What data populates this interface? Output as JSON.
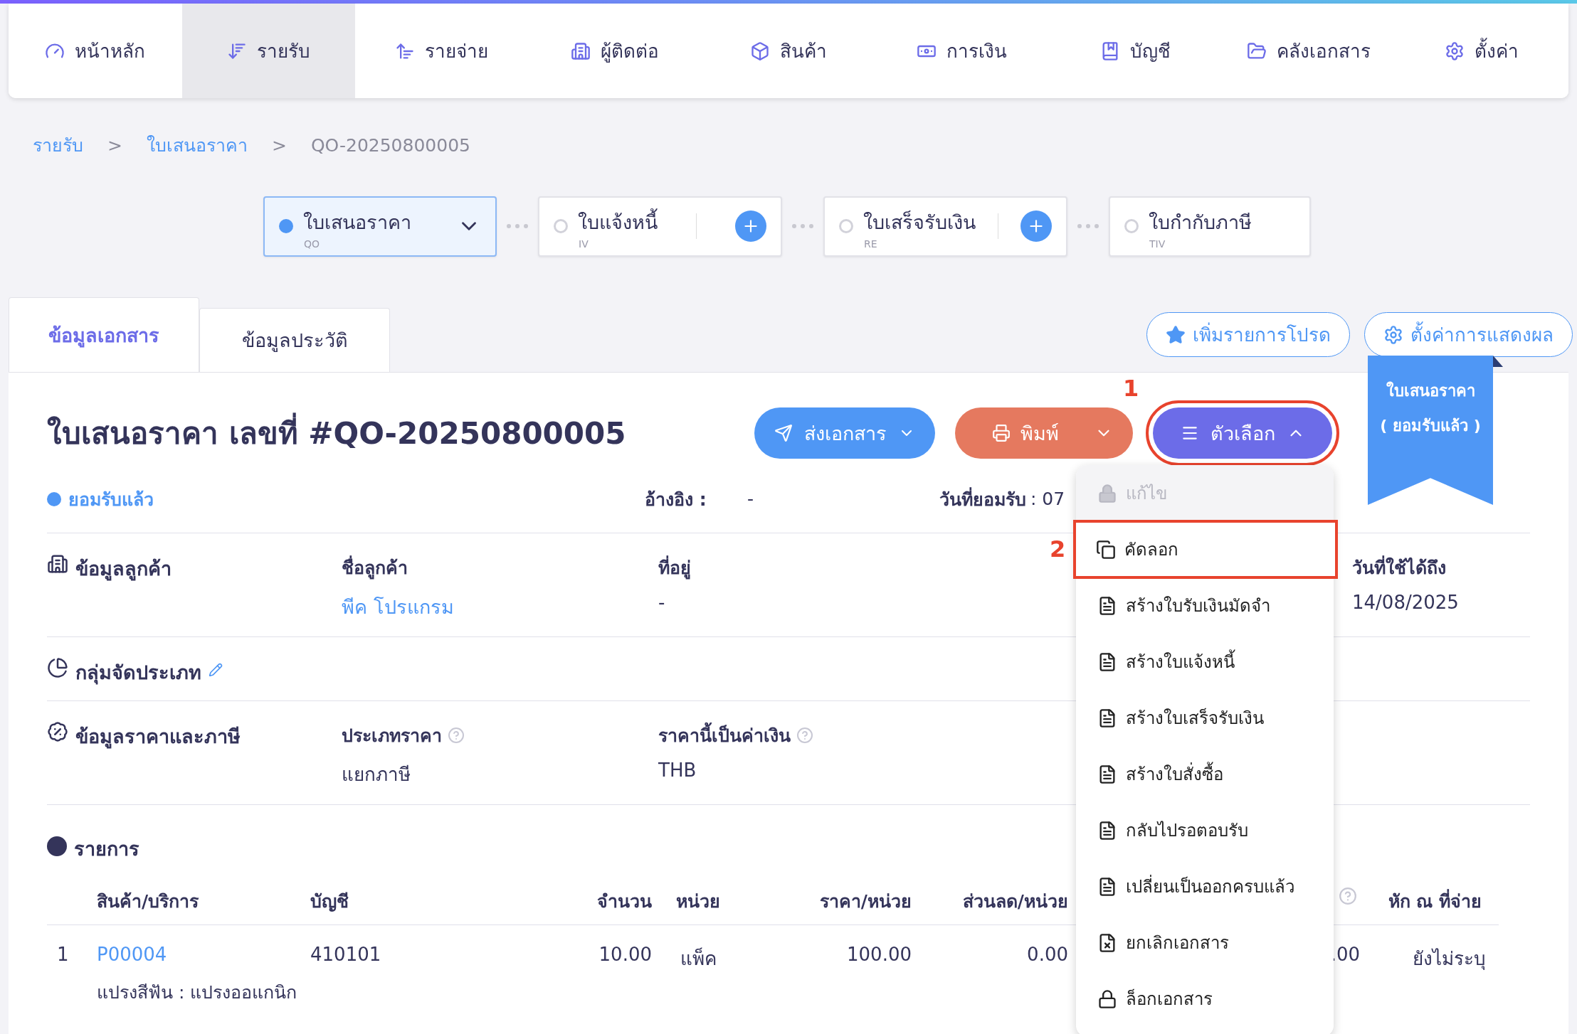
{
  "nav": [
    {
      "label": "หน้าหลัก",
      "selected": false
    },
    {
      "label": "รายรับ",
      "selected": true
    },
    {
      "label": "รายจ่าย",
      "selected": false
    },
    {
      "label": "ผู้ติดต่อ",
      "selected": false
    },
    {
      "label": "สินค้า",
      "selected": false
    },
    {
      "label": "การเงิน",
      "selected": false
    },
    {
      "label": "บัญชี",
      "selected": false
    },
    {
      "label": "คลังเอกสาร",
      "selected": false
    },
    {
      "label": "ตั้งค่า",
      "selected": false
    }
  ],
  "breadcrumb": {
    "separator": ">",
    "items": [
      {
        "label": "รายรับ",
        "kind": "link"
      },
      {
        "label": "ใบเสนอราคา",
        "kind": "link"
      },
      {
        "label": "QO-20250800005",
        "kind": "current"
      }
    ]
  },
  "flow": [
    {
      "label": "ใบเสนอราคา",
      "code": "QO",
      "selected": true,
      "addable": false
    },
    {
      "label": "ใบแจ้งหนี้",
      "code": "IV",
      "selected": false,
      "addable": true
    },
    {
      "label": "ใบเสร็จรับเงิน",
      "code": "RE",
      "selected": false,
      "addable": true
    },
    {
      "label": "ใบกำกับภาษี",
      "code": "TIV",
      "selected": false,
      "addable": false
    }
  ],
  "tabs": [
    {
      "label": "ข้อมูลเอกสาร",
      "selected": true
    },
    {
      "label": "ข้อมูลประวัติ",
      "selected": false
    }
  ],
  "favorite_button": "เพิ่มรายการโปรด",
  "display_settings_button": "ตั้งค่าการแสดงผล",
  "ribbon": [
    "ใบเสนอราคา",
    "( ยอมรับแล้ว )"
  ],
  "title": "ใบเสนอราคา เลขที่ #QO-20250800005",
  "actions": {
    "send": "ส่งเอกสาร",
    "print": "พิมพ์",
    "options": "ตัวเลือก",
    "options_expanded": true
  },
  "callouts": [
    "1",
    "2"
  ],
  "status": "ยอมรับแล้ว",
  "reference": {
    "label": "อ้างอิง :",
    "value": "-"
  },
  "accepted_date": {
    "label": "วันที่ยอมรับ",
    "value": ": 07"
  },
  "customer": {
    "heading": "ข้อมูลลูกค้า",
    "name_label": "ชื่อลูกค้า",
    "name": "พีค โปรแกรม",
    "address_label": "ที่อยู่",
    "address": "-",
    "valid_label": "วันที่ใช้ได้ถึง",
    "valid_until": "14/08/2025"
  },
  "group": {
    "heading": "กลุ่มจัดประเภท"
  },
  "pricing": {
    "heading": "ข้อมูลราคาและภาษี",
    "type_label": "ประเภทราคา",
    "type": "แยกภาษี",
    "currency_label": "ราคานี้เป็นค่าเงิน",
    "currency": "THB"
  },
  "items": {
    "heading": "รายการ",
    "columns": [
      "สินค้า/บริการ",
      "บัญชี",
      "จำนวน",
      "หน่วย",
      "ราคา/หน่วย",
      "ส่วนลด/หน่วย",
      "หัก ณ ที่จ่าย"
    ],
    "rows": [
      {
        "no": "1",
        "product": "P00004",
        "account": "410101",
        "qty": "10.00",
        "unit": "แพ็ค",
        "price": "100.00",
        "discount": "0.00",
        "column_8": ".00",
        "wht": "ยังไม่ระบุ",
        "description": "แปรงสีฟัน : แปรงออแกนิก"
      }
    ]
  },
  "menu": [
    {
      "label": "แก้ไข",
      "disabled": true,
      "annotated": false
    },
    {
      "label": "คัดลอก",
      "disabled": false,
      "annotated": true
    },
    {
      "label": "สร้างใบรับเงินมัดจำ",
      "disabled": false,
      "annotated": false
    },
    {
      "label": "สร้างใบแจ้งหนี้",
      "disabled": false,
      "annotated": false
    },
    {
      "label": "สร้างใบเสร็จรับเงิน",
      "disabled": false,
      "annotated": false
    },
    {
      "label": "สร้างใบสั่งซื้อ",
      "disabled": false,
      "annotated": false
    },
    {
      "label": "กลับไปรอตอบรับ",
      "disabled": false,
      "annotated": false
    },
    {
      "label": "เปลี่ยนเป็นออกครบแล้ว",
      "disabled": false,
      "annotated": false
    },
    {
      "label": "ยกเลิกเอกสาร",
      "disabled": false,
      "annotated": false
    },
    {
      "label": "ล็อกเอกสาร",
      "disabled": false,
      "annotated": false
    }
  ]
}
